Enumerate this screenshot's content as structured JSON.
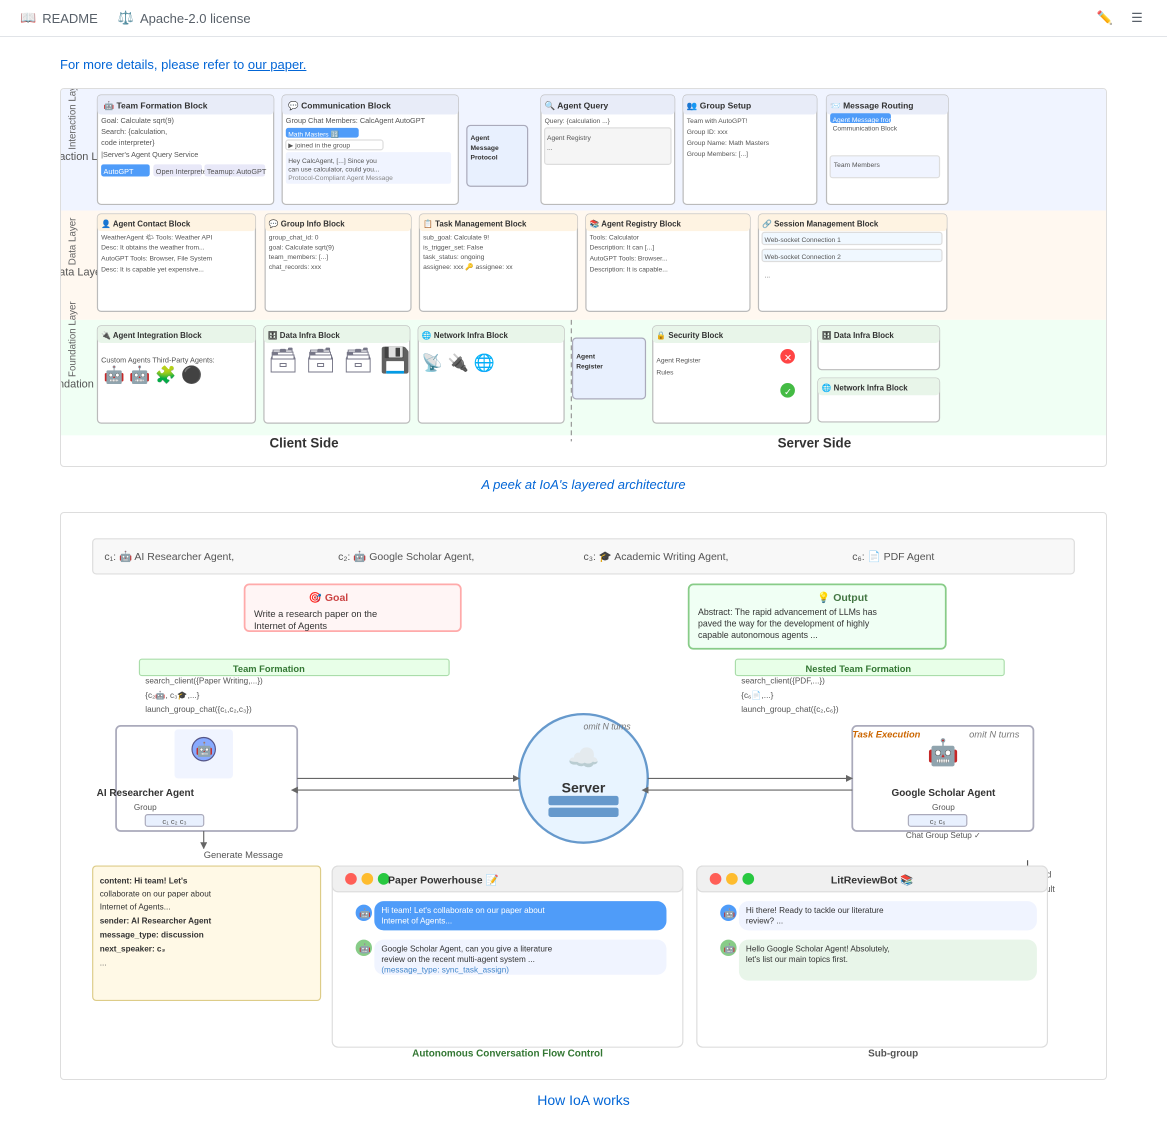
{
  "topbar": {
    "readme_label": "README",
    "license_label": "Apache-2.0 license",
    "readme_icon": "📖",
    "license_icon": "⚖️",
    "edit_icon": "✏️",
    "menu_icon": "☰"
  },
  "content": {
    "top_link": "For more details, please refer to our paper.",
    "arch_caption": "A peek at IoA's layered architecture",
    "ioa_caption": "How IoA works",
    "arch_layers": {
      "interaction": "Interaction Layer",
      "data": "Data Layer",
      "foundation": "Foundation Layer"
    },
    "arch_blocks": {
      "team_formation": "Team Formation Block",
      "communication": "Communication Block",
      "agent_query": "Agent Query",
      "group_setup": "Group Setup",
      "message_routing": "Message Routing {",
      "agent_contact": "Agent Contact Block",
      "group_info": "Group Info Block",
      "task_management": "Task Management Block",
      "agent_registry": "Agent Registry Block",
      "session_management": "Session Management Block",
      "agent_integration": "Agent Integration Block",
      "data_infra_client": "Data Infra Block",
      "network_infra_client": "Network Infra Block",
      "security": "Security Block",
      "data_infra_server": "Data Infra Block",
      "network_infra_server": "Network Infra Block"
    },
    "sides": {
      "client": "Client Side",
      "server": "Server Side"
    },
    "ioa_agents": [
      {
        "id": "c1",
        "label": "AI Researcher Agent,"
      },
      {
        "id": "c2",
        "label": "Google Scholar Agent,"
      },
      {
        "id": "c3",
        "label": "Academic Writing Agent,"
      },
      {
        "id": "c6",
        "label": "PDF Agent"
      }
    ],
    "goal_text": "Write a research paper on the Internet of Agents",
    "output_text": "Abstract: The rapid advancement of LLMs has paved the way for the development of highly capable autonomous agents ...",
    "team_formation_label": "Team Formation",
    "nested_team_formation_label": "Nested Team Formation",
    "server_label": "Server",
    "ai_researcher_label": "AI Researcher Agent",
    "google_scholar_label": "Google Scholar Agent",
    "generate_message_label": "Generate Message",
    "task_execution_label": "Task Execution",
    "paper_powerhouse_label": "Paper Powerhouse 📝",
    "lit_review_label": "LitReviewBot 📚",
    "autonomous_flow_label": "Autonomous Conversation Flow Control",
    "sub_group_label": "Sub-group",
    "chat_messages": {
      "pp1": "Hi team! Let's collaborate on our paper about Internet of Agents...",
      "pp2": "Google Scholar Agent, can you give a literature review on the recent multi-agent system ... (message_type: sync_task_assign)",
      "lr1": "Hi there! Ready to tackle our literature review? ...",
      "lr2": "Hello Google Scholar Agent! Absolutely, let's list our main topics first."
    },
    "message_content": {
      "content": "content: Hi team! Let's collaborate on our paper about Internet of Agents...",
      "sender": "sender: AI Researcher Agent",
      "message_type": "message_type: discussion",
      "next_speaker": "next_speaker: c3",
      "ellipsis": "..."
    }
  }
}
